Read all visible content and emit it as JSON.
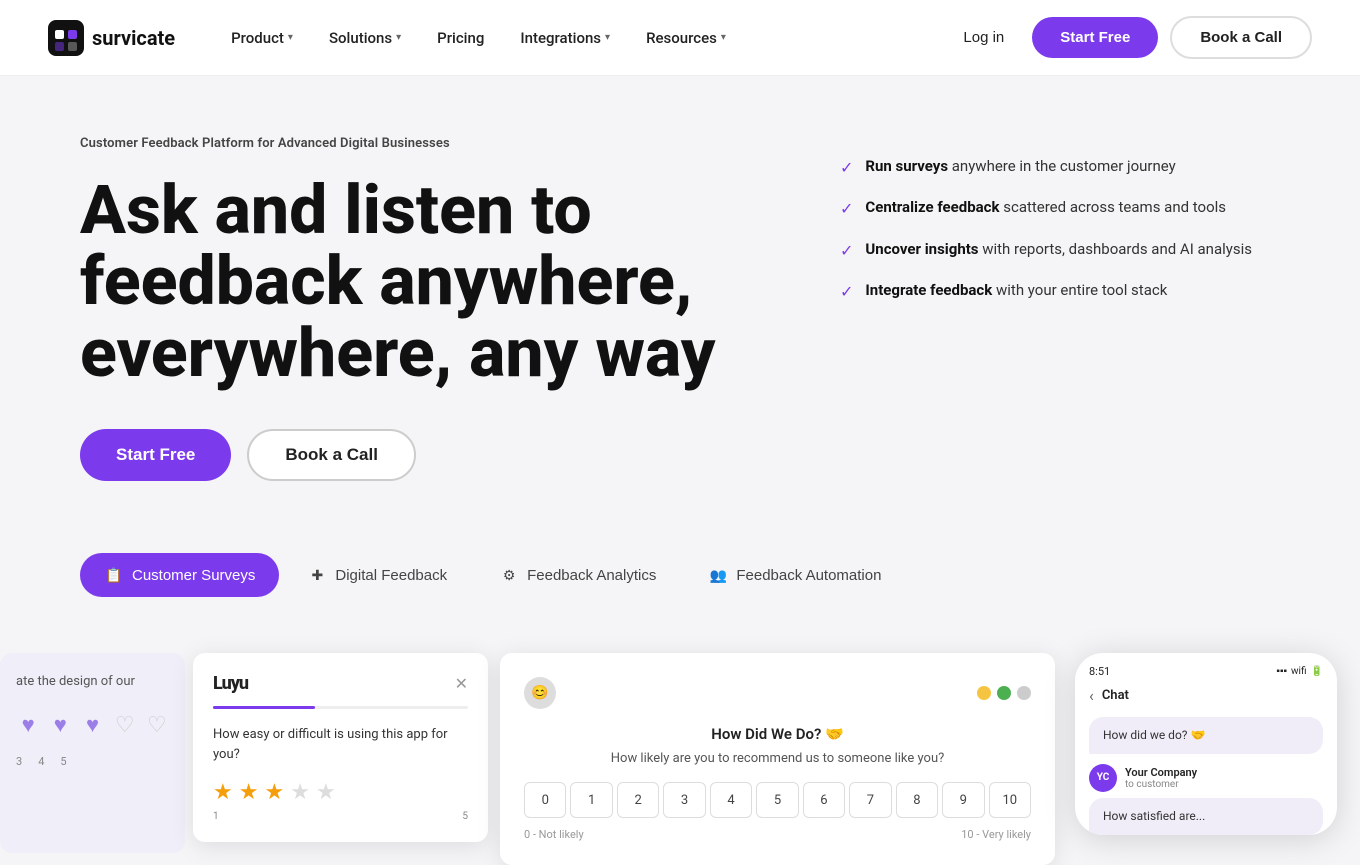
{
  "brand": {
    "name": "survicate",
    "logoAlt": "Survicate logo"
  },
  "nav": {
    "links": [
      {
        "label": "Product",
        "hasChevron": true
      },
      {
        "label": "Solutions",
        "hasChevron": true
      },
      {
        "label": "Pricing",
        "hasChevron": false
      },
      {
        "label": "Integrations",
        "hasChevron": true
      },
      {
        "label": "Resources",
        "hasChevron": true
      }
    ],
    "login": "Log in",
    "startFree": "Start Free",
    "bookCall": "Book a Call"
  },
  "hero": {
    "tag": "Customer Feedback Platform for Advanced Digital Businesses",
    "titleLine1": "Ask and listen to",
    "titleLine2": "feedback anywhere,",
    "titleLine3": "everywhere, any way",
    "ctaStart": "Start Free",
    "ctaBook": "Book a Call",
    "features": [
      {
        "bold": "Run surveys",
        "rest": " anywhere in the customer journey"
      },
      {
        "bold": "Centralize feedback",
        "rest": " scattered across teams and tools"
      },
      {
        "bold": "Uncover insights",
        "rest": " with reports, dashboards and AI analysis"
      },
      {
        "bold": "Integrate feedback",
        "rest": " with your entire tool stack"
      }
    ]
  },
  "tabs": [
    {
      "label": "Customer Surveys",
      "icon": "📋",
      "active": true
    },
    {
      "label": "Digital Feedback",
      "icon": "✚",
      "active": false
    },
    {
      "label": "Feedback Analytics",
      "icon": "⚙",
      "active": false
    },
    {
      "label": "Feedback Automation",
      "icon": "👥",
      "active": false
    }
  ],
  "survey_card": {
    "logo": "Luyu",
    "question": "How easy or difficult is using this app for you?",
    "stars": 3,
    "total_stars": 5,
    "label_left": "1",
    "label_right": "5"
  },
  "nps_card": {
    "title": "How Did We Do? 🤝",
    "subquestion": "How likely are you to recommend us to someone like you?",
    "scale": [
      "0",
      "1",
      "2",
      "3",
      "4",
      "5",
      "6",
      "7",
      "8",
      "9",
      "10"
    ],
    "footer_left": "0 - Not likely",
    "footer_right": "10 - Very likely"
  },
  "mobile_card": {
    "time": "8:51",
    "title": "Your Company",
    "subtitle": "to customer",
    "question": "How did we do? 🤝",
    "company_initials": "YC",
    "second_question": "How satisfied are..."
  },
  "partial_left": {
    "text": "ate the design of our",
    "numbers": [
      "3",
      "4",
      "5"
    ]
  }
}
